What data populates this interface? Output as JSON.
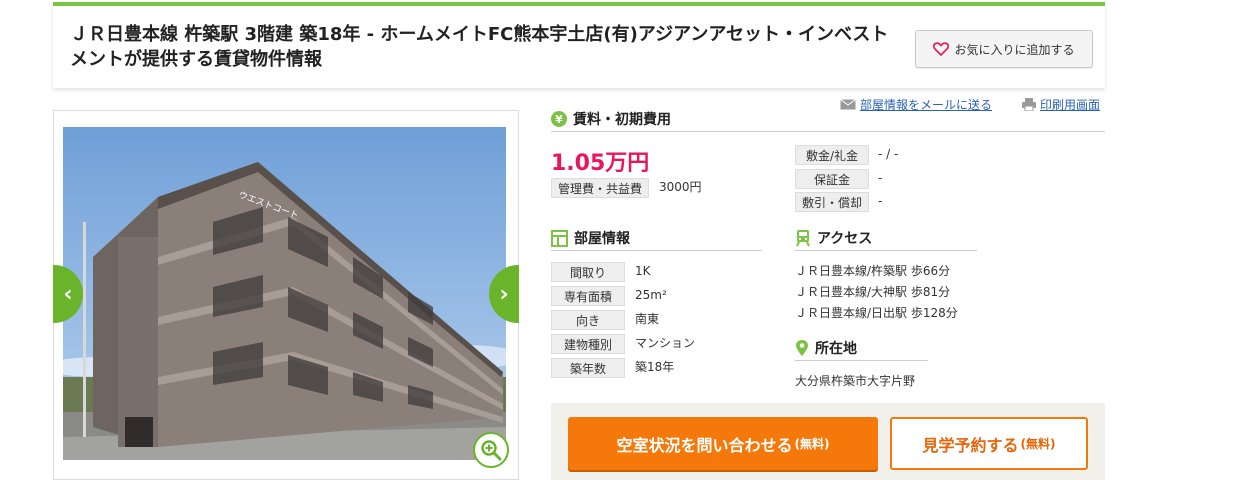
{
  "header": {
    "title": "ＪＲ日豊本線 杵築駅 3階建 築18年 - ホームメイトFC熊本宇土店(有)アジアンアセット・インベストメントが提供する賃貸物件情報",
    "favorite_label": "お気に入りに追加する"
  },
  "links": {
    "mail": "部屋情報をメールに送る",
    "print": "印刷用画面"
  },
  "rent": {
    "heading": "賃料・初期費用",
    "price": "1.05万円",
    "mgmt_label": "管理費・共益費",
    "mgmt_value": "3000円",
    "deposit_label": "敷金/礼金",
    "deposit_value": "- / -",
    "guarantee_label": "保証金",
    "guarantee_value": "-",
    "shikibiki_label": "敷引・償却",
    "shikibiki_value": "-"
  },
  "room": {
    "heading": "部屋情報",
    "rows": [
      {
        "label": "間取り",
        "value": "1K"
      },
      {
        "label": "専有面積",
        "value": "25m²"
      },
      {
        "label": "向き",
        "value": "南東"
      },
      {
        "label": "建物種別",
        "value": "マンション"
      },
      {
        "label": "築年数",
        "value": "築18年"
      }
    ]
  },
  "access": {
    "heading": "アクセス",
    "lines": [
      "ＪＲ日豊本線/杵築駅 歩66分",
      "ＪＲ日豊本線/大神駅 歩81分",
      "ＪＲ日豊本線/日出駅 歩128分"
    ]
  },
  "location": {
    "heading": "所在地",
    "address": "大分県杵築市大字片野"
  },
  "photo": {
    "sign_text": "ウエストコート"
  },
  "cta": {
    "inquiry_label": "空室状況を問い合わせる",
    "inquiry_note": "(無料)",
    "visit_label": "見学予約する",
    "visit_note": "(無料)"
  },
  "colors": {
    "accent_green": "#7cc243",
    "price_pink": "#e8175d",
    "cta_orange": "#f5790a"
  }
}
